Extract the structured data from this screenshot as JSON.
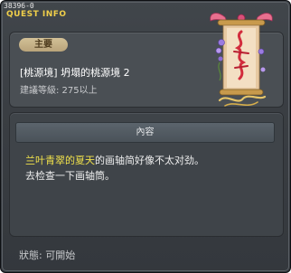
{
  "window": {
    "quest_id": "38396-0",
    "title": "QUEST INFO"
  },
  "info": {
    "badge": "主要",
    "quest_name": "[桃源境] 坍塌的桃源境 2",
    "recommended_level": "建議等級: 275以上"
  },
  "content": {
    "header": "內容",
    "line1_highlight": "兰叶青翠的夏天",
    "line1_rest": "的画轴简好像不太对劲。",
    "line2": "去检查一下画轴筒。"
  },
  "status": "狀態: 可開始",
  "colors": {
    "title": "#f0cf4a",
    "highlight": "#f1e24b",
    "badge": "#c9b78d"
  },
  "icons": {
    "scroll": "quest-scroll-icon"
  }
}
